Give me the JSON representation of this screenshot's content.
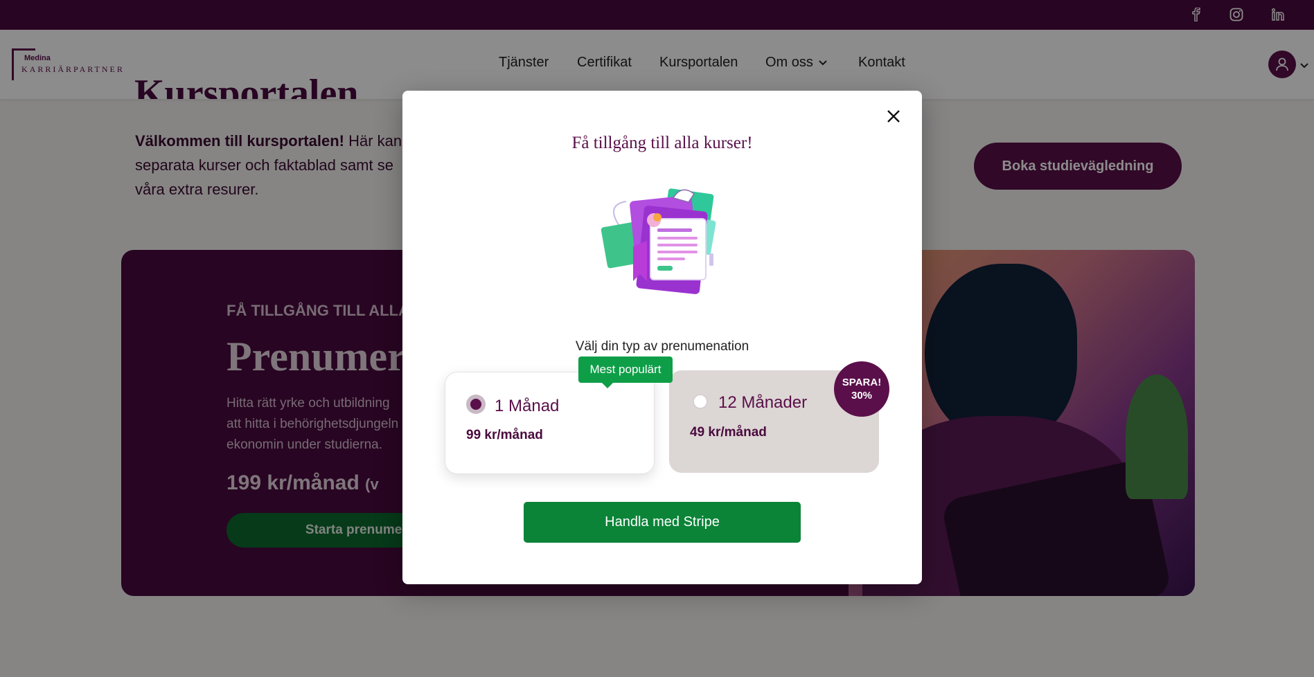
{
  "topbar": {
    "social": [
      {
        "name": "facebook-icon"
      },
      {
        "name": "instagram-icon"
      },
      {
        "name": "linkedin-icon"
      }
    ]
  },
  "header": {
    "logo_small": "Medina",
    "logo_big": "KARRIÄRPARTNER",
    "nav": [
      {
        "label": "Tjänster"
      },
      {
        "label": "Certifikat"
      },
      {
        "label": "Kursportalen"
      },
      {
        "label": "Om oss"
      },
      {
        "label": "Kontakt"
      }
    ]
  },
  "page": {
    "title": "Kursportalen",
    "intro_bold": "Välkommen till kursportalen!",
    "intro_line1_rest": " Här kan",
    "intro_line2": "separata kurser och faktablad samt se",
    "intro_line3": "våra extra resurer.",
    "book_button": "Boka studievägledning",
    "promo": {
      "kicker": "FÅ TILLGÅNG TILL ALLA",
      "title": "Prenumeration",
      "desc_line1": "Hitta rätt yrke och utbildning",
      "desc_line2": "att hitta i behörighetsdjungeln",
      "desc_line3": "ekonomin under studierna.",
      "price": "199 kr/månad",
      "price_suffix": "(v",
      "start_button": "Starta prenumeration"
    }
  },
  "modal": {
    "title": "Få tillgång till alla kurser!",
    "choose_label": "Välj din typ av prenumenation",
    "popular_badge": "Mest populärt",
    "save_badge_line1": "SPARA!",
    "save_badge_line2": "30%",
    "plans": [
      {
        "name": "1 Månad",
        "price": "99 kr/månad",
        "selected": true
      },
      {
        "name": "12 Månader",
        "price": "49 kr/månad",
        "selected": false
      }
    ],
    "checkout_button": "Handla med Stripe"
  },
  "colors": {
    "brand": "#5a0f4a",
    "topbar": "#4a0a3e",
    "accent_green": "#0b8438",
    "badge_green": "#0f9e48"
  }
}
